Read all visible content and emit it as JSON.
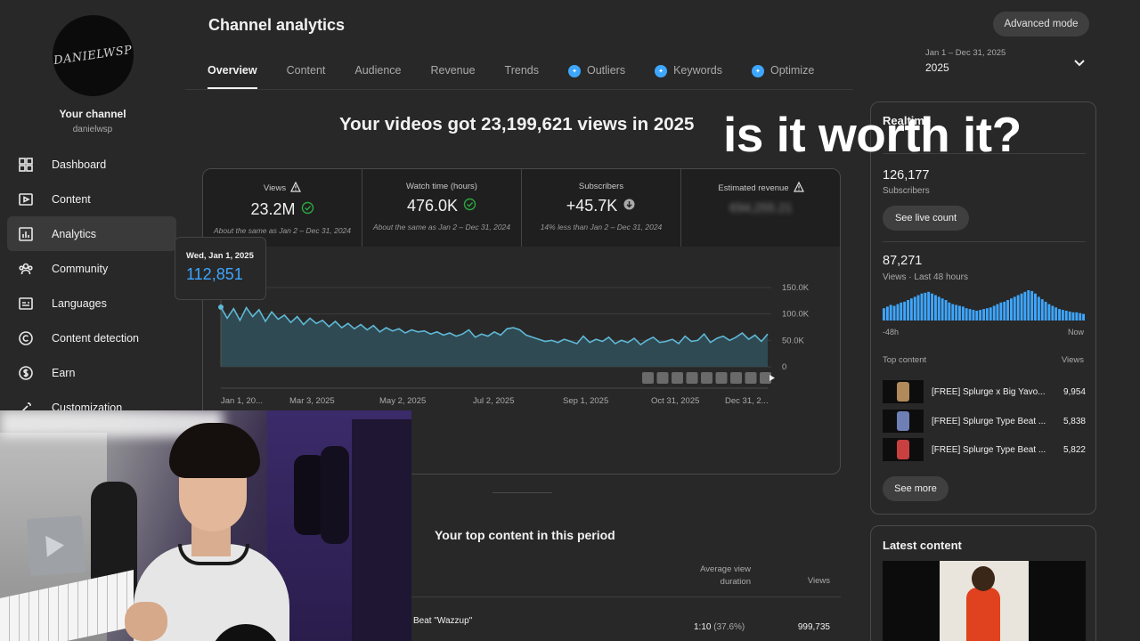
{
  "channel": {
    "avatar_text": "DANIELWSP",
    "your_channel": "Your channel",
    "handle": "danielwsp"
  },
  "sidebar": {
    "items": [
      {
        "label": "Dashboard",
        "icon": "dashboard-icon"
      },
      {
        "label": "Content",
        "icon": "content-icon"
      },
      {
        "label": "Analytics",
        "icon": "analytics-icon",
        "active": true
      },
      {
        "label": "Community",
        "icon": "community-icon"
      },
      {
        "label": "Languages",
        "icon": "languages-icon"
      },
      {
        "label": "Content detection",
        "icon": "copyright-icon"
      },
      {
        "label": "Earn",
        "icon": "dollar-icon"
      },
      {
        "label": "Customization",
        "icon": "wand-icon"
      }
    ]
  },
  "header": {
    "title": "Channel analytics",
    "advanced_mode": "Advanced mode",
    "tabs": [
      {
        "label": "Overview",
        "active": true
      },
      {
        "label": "Content"
      },
      {
        "label": "Audience"
      },
      {
        "label": "Revenue"
      },
      {
        "label": "Trends"
      },
      {
        "label": "Outliers",
        "icon": "spark-icon"
      },
      {
        "label": "Keywords",
        "icon": "spark-icon"
      },
      {
        "label": "Optimize",
        "icon": "spark-icon"
      }
    ],
    "date_range": "Jan 1 – Dec 31, 2025",
    "date_year": "2025"
  },
  "headline": "Your videos got 23,199,621 views in 2025",
  "overlay_text": "is it worth it?",
  "metrics": [
    {
      "label": "Views",
      "value": "23.2M",
      "sub": "About the same as Jan 2 – Dec 31, 2024",
      "warn": true,
      "status": "check"
    },
    {
      "label": "Watch time (hours)",
      "value": "476.0K",
      "sub": "About the same as Jan 2 – Dec 31, 2024",
      "warn": false,
      "status": "check"
    },
    {
      "label": "Subscribers",
      "value": "+45.7K",
      "sub": "14% less than Jan 2 – Dec 31, 2024",
      "warn": false,
      "status": "down"
    },
    {
      "label": "Estimated revenue",
      "value": "€94,255.21",
      "sub": "",
      "warn": true,
      "blurred": true
    }
  ],
  "tooltip": {
    "date": "Wed, Jan 1, 2025",
    "value": "112,851"
  },
  "chart_data": {
    "type": "area",
    "series": [
      {
        "values": [
          112851,
          92000,
          110000,
          88000,
          112000,
          95000,
          108000,
          86000,
          104000,
          90000,
          98000,
          84000,
          95000,
          80000,
          92000,
          82000,
          88000,
          76000,
          86000,
          74000,
          82000,
          72000,
          80000,
          70000,
          78000,
          66000,
          74000,
          68000,
          72000,
          64000,
          70000,
          66000,
          68000,
          62000,
          66000,
          60000,
          64000,
          58000,
          62000,
          70000,
          56000,
          62000,
          58000,
          66000,
          60000,
          72000,
          74000,
          70000,
          60000,
          56000,
          52000,
          48000,
          50000,
          46000,
          52000,
          48000,
          44000,
          58000,
          46000,
          52000,
          48000,
          56000,
          44000,
          50000,
          46000,
          54000,
          42000,
          50000,
          56000,
          46000,
          48000,
          52000,
          44000,
          58000,
          48000,
          50000,
          62000,
          46000,
          54000,
          58000,
          50000,
          56000,
          64000,
          52000,
          60000,
          48000,
          62000
        ]
      }
    ],
    "x_tick_labels": [
      "Jan 1, 20...",
      "Mar 3, 2025",
      "May 2, 2025",
      "Jul 2, 2025",
      "Sep 1, 2025",
      "Oct 31, 2025",
      "Dec 31, 2..."
    ],
    "y_tick_labels": [
      "150.0K",
      "100.0K",
      "50.0K",
      "0"
    ],
    "ylim": [
      0,
      150000
    ],
    "color": "#5fb8d6",
    "fill": "#2f4a52"
  },
  "realtime": {
    "title": "Realtime",
    "subs_value": "126,177",
    "subs_label": "Subscribers",
    "live_count_btn": "See live count",
    "views_value": "87,271",
    "views_label": "Views · Last 48 hours",
    "axis_left": "-48h",
    "axis_right": "Now",
    "bars": [
      30,
      34,
      38,
      36,
      40,
      44,
      46,
      50,
      54,
      58,
      62,
      66,
      68,
      70,
      66,
      62,
      58,
      54,
      50,
      44,
      40,
      38,
      36,
      34,
      30,
      28,
      26,
      24,
      26,
      28,
      30,
      32,
      36,
      40,
      44,
      46,
      50,
      54,
      58,
      62,
      66,
      70,
      74,
      72,
      66,
      58,
      52,
      46,
      40,
      36,
      32,
      28,
      26,
      24,
      22,
      20,
      20,
      18,
      16
    ],
    "top_content_label": "Top content",
    "views_col_label": "Views",
    "rows": [
      {
        "title": "[FREE] Splurge x Big Yavo...",
        "views": "9,954",
        "thumb_color": "#b08a5a"
      },
      {
        "title": "[FREE] Splurge Type Beat ...",
        "views": "5,838",
        "thumb_color": "#6e7fb5"
      },
      {
        "title": "[FREE] Splurge Type Beat ...",
        "views": "5,822",
        "thumb_color": "#c94040"
      }
    ],
    "see_more": "See more"
  },
  "latest": {
    "title": "Latest content"
  },
  "top_content": {
    "title": "Your top content in this period",
    "col_avd": "Average view duration",
    "col_views": "Views",
    "row": {
      "title": "Beat \"Wazzup\"",
      "duration": "1:10",
      "pct": "(37.6%)",
      "views": "999,735"
    }
  }
}
